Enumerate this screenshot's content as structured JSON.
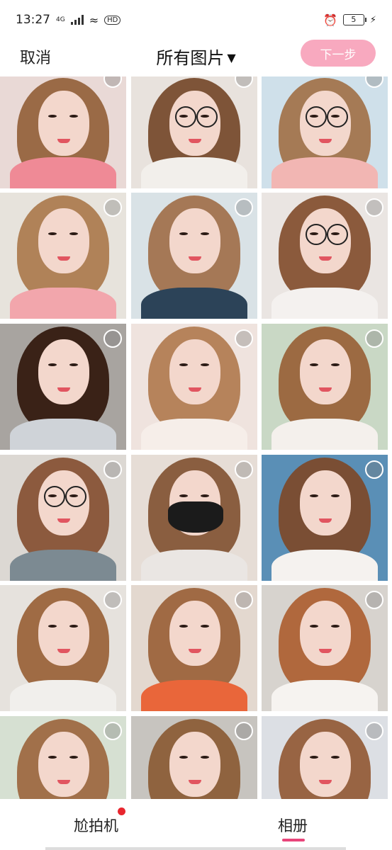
{
  "status": {
    "time": "13:27",
    "network": "4G",
    "hd": "HD",
    "battery": "5"
  },
  "nav": {
    "cancel_label": "取消",
    "title": "所有图片",
    "title_caret": "▼",
    "next_label": "下一步"
  },
  "tabs": {
    "camera_label": "尬拍机",
    "album_label": "相册"
  },
  "colors": {
    "accent": "#e8457a",
    "next_button": "#f8a9bf",
    "badge": "#e8262e"
  },
  "photos": [
    {
      "bg": "#e9d9d6",
      "hair": "#9a6a46",
      "shirt": "#ef8a96",
      "glasses": false,
      "mask": false
    },
    {
      "bg": "#e8e2dd",
      "hair": "#7e5438",
      "shirt": "#f2efeb",
      "glasses": true,
      "mask": false
    },
    {
      "bg": "#cfe0ea",
      "hair": "#a57a55",
      "shirt": "#f2b6b3",
      "glasses": true,
      "mask": false
    },
    {
      "bg": "#e7e3dc",
      "hair": "#b08258",
      "shirt": "#f2a6ac",
      "glasses": false,
      "mask": false
    },
    {
      "bg": "#d9e2e6",
      "hair": "#a57856",
      "shirt": "#2c4358",
      "glasses": false,
      "mask": false
    },
    {
      "bg": "#eae5e2",
      "hair": "#8b5a3c",
      "shirt": "#f4f1ef",
      "glasses": true,
      "mask": false
    },
    {
      "bg": "#a8a4a0",
      "hair": "#3a2217",
      "shirt": "#cfd3d8",
      "glasses": false,
      "mask": false
    },
    {
      "bg": "#efe3de",
      "hair": "#b6835b",
      "shirt": "#f6eee9",
      "glasses": false,
      "mask": false
    },
    {
      "bg": "#c9d8c5",
      "hair": "#9c6a42",
      "shirt": "#f4f0ec",
      "glasses": false,
      "mask": false
    },
    {
      "bg": "#dcd8d3",
      "hair": "#8c5a3e",
      "shirt": "#7c8a92",
      "glasses": true,
      "mask": false
    },
    {
      "bg": "#e6ddd6",
      "hair": "#8a5e40",
      "shirt": "#eae6e3",
      "glasses": false,
      "mask": true
    },
    {
      "bg": "#5a8fb6",
      "hair": "#7a4e34",
      "shirt": "#f5f2ef",
      "glasses": false,
      "mask": false
    },
    {
      "bg": "#e6e2dd",
      "hair": "#9f6b44",
      "shirt": "#f1efec",
      "glasses": false,
      "mask": false
    },
    {
      "bg": "#e3d8cf",
      "hair": "#a06a44",
      "shirt": "#e9663a",
      "glasses": false,
      "mask": false
    },
    {
      "bg": "#d7d3ce",
      "hair": "#b0683d",
      "shirt": "#f6f3f0",
      "glasses": false,
      "mask": false
    },
    {
      "bg": "#d6e0d2",
      "hair": "#a1704a",
      "shirt": "#8a8f94",
      "glasses": false,
      "mask": false
    },
    {
      "bg": "#c7c4bf",
      "hair": "#8f633f",
      "shirt": "#f0ede9",
      "glasses": false,
      "mask": false
    },
    {
      "bg": "#dcdfe4",
      "hair": "#986443",
      "shirt": "#f4f1ee",
      "glasses": false,
      "mask": false
    }
  ]
}
